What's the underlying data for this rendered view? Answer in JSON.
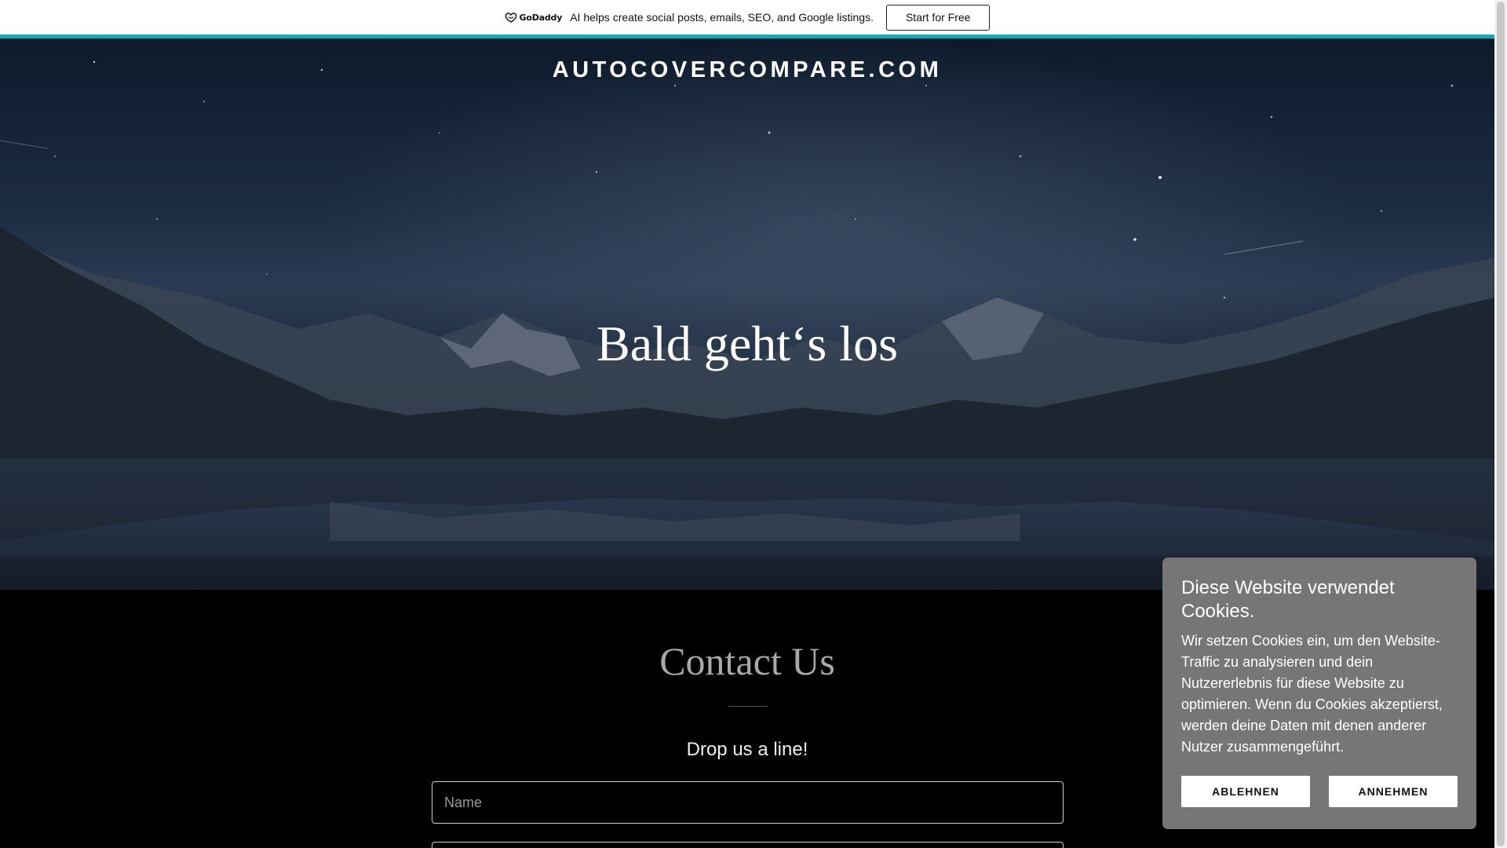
{
  "promo": {
    "brand": "GoDaddy",
    "message": "AI helps create social posts, emails, SEO, and Google listings.",
    "cta_label": "Start for Free",
    "accent_color": "#1aa6b3"
  },
  "hero": {
    "site_title": "AUTOCOVERCOMPARE.COM",
    "heading": "Bald geht‘s los"
  },
  "contact": {
    "title": "Contact Us",
    "subtitle": "Drop us a line!",
    "name_placeholder": "Name",
    "email_placeholder": ""
  },
  "cookie": {
    "title": "Diese Website verwendet Cookies.",
    "body": "Wir setzen Cookies ein, um den Website-Traffic zu analysieren und dein Nutzererlebnis für diese Website zu optimieren. Wenn du Cookies akzeptierst, werden deine Daten mit denen anderer Nutzer zusammengeführt.",
    "decline_label": "ABLEHNEN",
    "accept_label": "ANNEHMEN",
    "background_color": "#767676"
  }
}
